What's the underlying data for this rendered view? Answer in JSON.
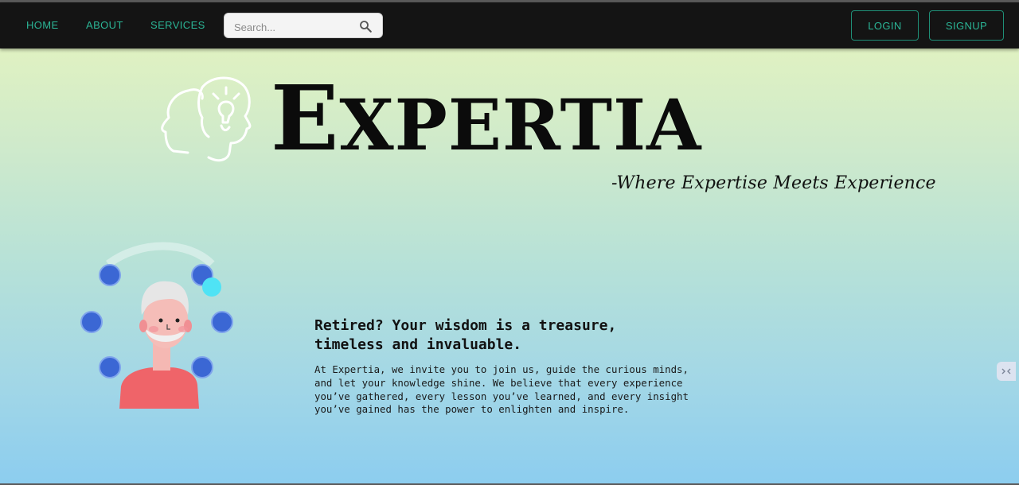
{
  "nav": {
    "links": [
      "HOME",
      "ABOUT",
      "SERVICES"
    ],
    "search_placeholder": "Search...",
    "login_label": "LOGIN",
    "signup_label": "SIGNUP"
  },
  "hero": {
    "brand_first": "E",
    "brand_rest": "XPERTIA",
    "tagline": "-Where Expertise Meets Experience"
  },
  "intro": {
    "headline": "Retired? Your wisdom is a treasure, timeless and invaluable.",
    "body": "At Expertia, we invite you to join us, guide the curious minds, and let your knowledge shine. We believe that every experience you’ve gathered, every lesson you’ve learned, and every insight you’ve gained has the power to enlighten and inspire."
  },
  "icons": {
    "search": "search-icon",
    "logo": "head-lightbulb-logo-icon",
    "chat": "chat-widget-icon"
  },
  "colors": {
    "navbar": "#141414",
    "accent": "#2bb596",
    "gradient_top": "#e8f5bd",
    "gradient_bottom": "#8ccdef",
    "orbit_dots": "#3b67d4",
    "highlight_dot": "#4fe3f5",
    "shirt": "#ef6469"
  }
}
